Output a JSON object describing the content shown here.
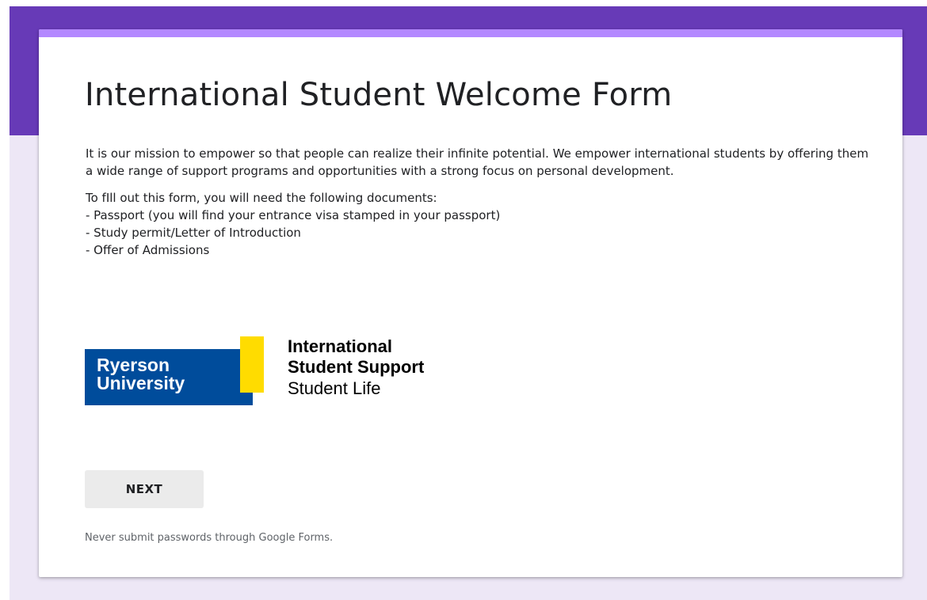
{
  "colors": {
    "header_band": "#673ab7",
    "card_accent": "#b388ff",
    "page_background": "#ede7f6",
    "ryerson_blue": "#004c9b",
    "ryerson_yellow": "#ffdc00"
  },
  "form": {
    "title": "International Student Welcome Form",
    "description_intro": "It is our mission to empower so that people can realize their infinite potential. We empower international students  by offering them a wide range of support programs and opportunities with a strong focus on personal development.",
    "documents_heading": "To fIll out this form, you will need the following documents:",
    "documents": [
      "- Passport (you will find your entrance visa stamped in your passport)",
      "- Study permit/Letter of Introduction",
      "- Offer of Admissions"
    ]
  },
  "logo": {
    "university_line1": "Ryerson",
    "university_line2": "University",
    "dept_line1": "International",
    "dept_line2": "Student Support",
    "dept_line3": "Student Life"
  },
  "actions": {
    "next_label": "NEXT"
  },
  "footer": {
    "note": "Never submit passwords through Google Forms."
  }
}
